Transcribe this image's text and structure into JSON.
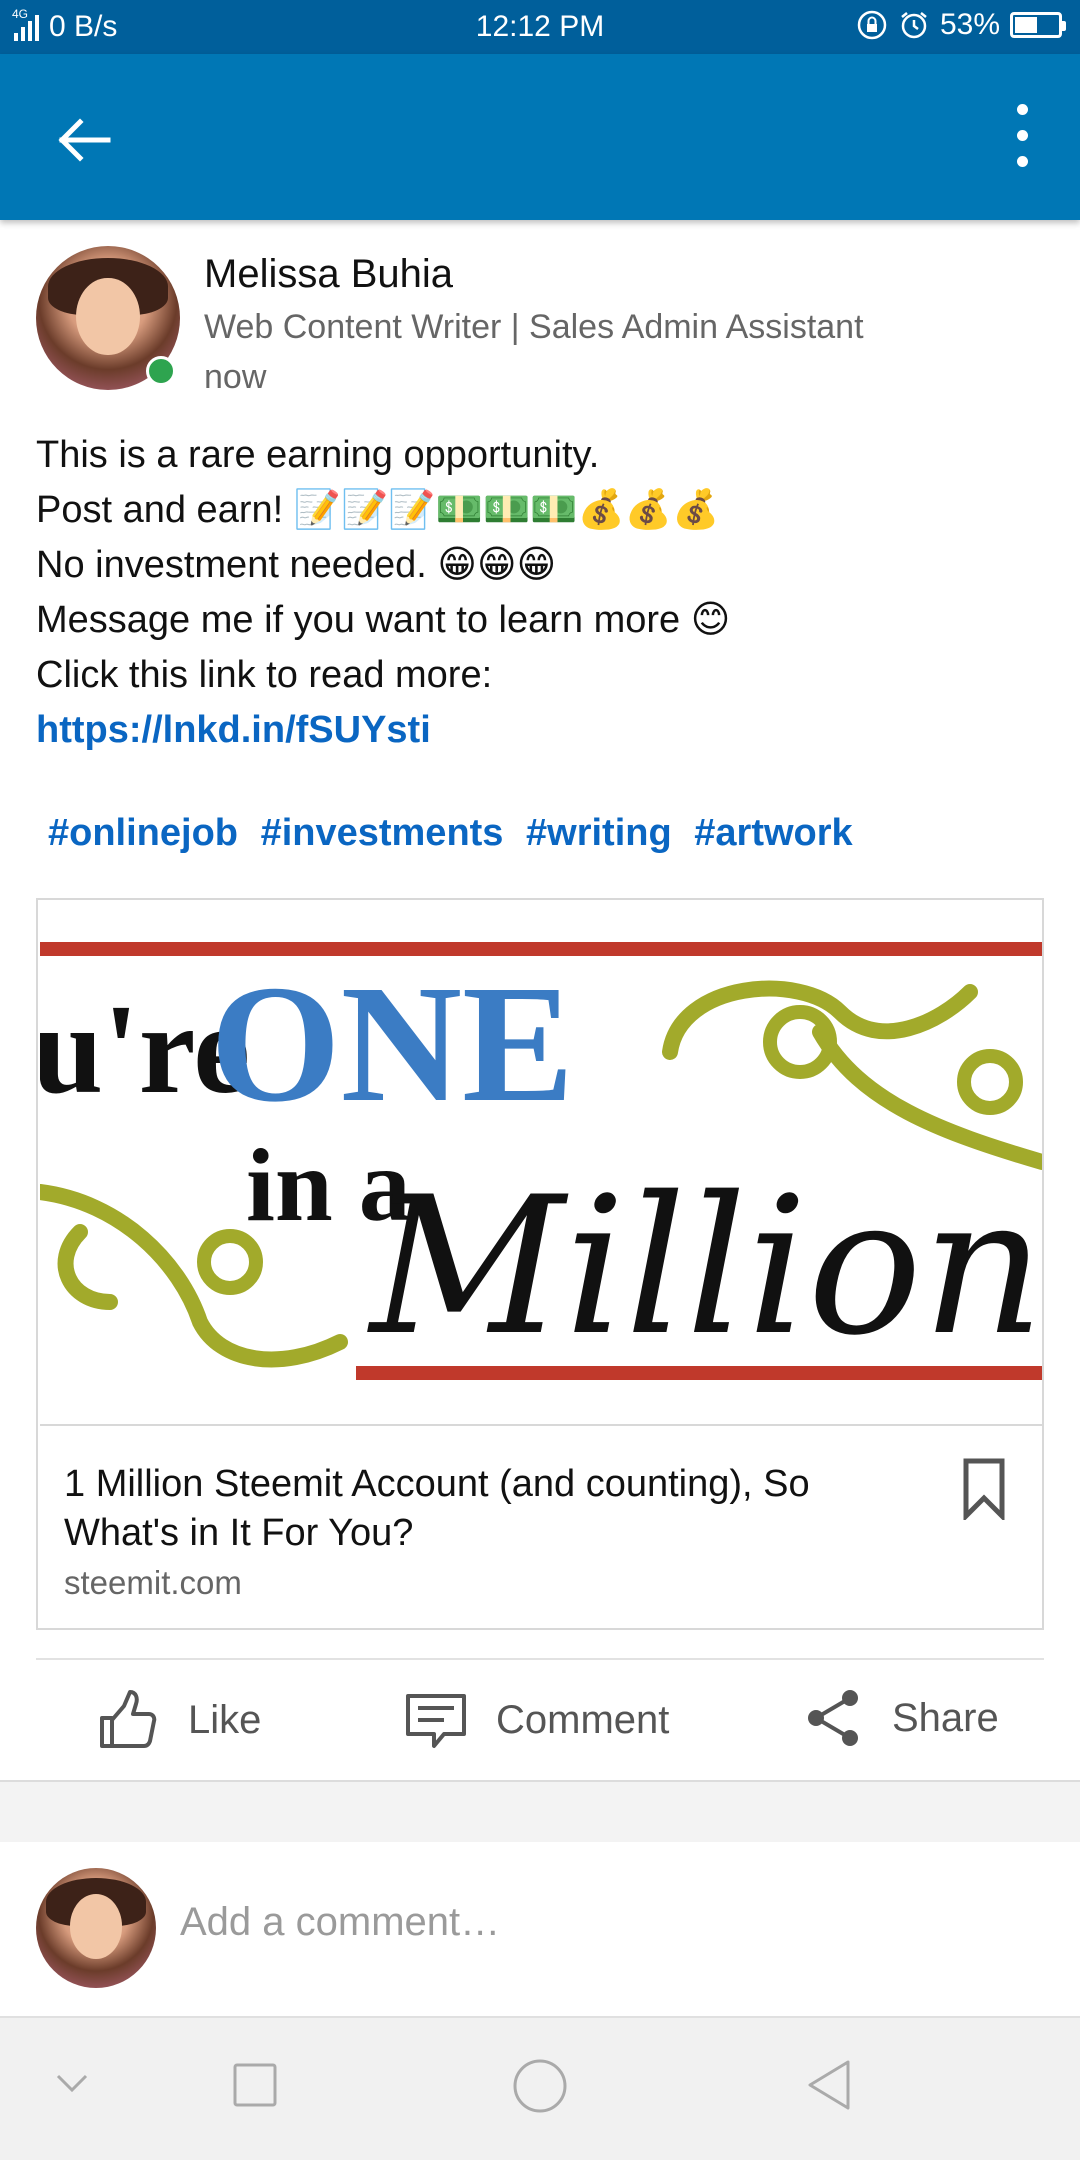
{
  "status_bar": {
    "network": "4G",
    "speed": "0 B/s",
    "time": "12:12 PM",
    "battery": "53%",
    "battery_level": 0.53
  },
  "app_bar": {
    "back_icon": "arrow-left-icon",
    "more_icon": "more-vertical-icon"
  },
  "post": {
    "author": {
      "name": "Melissa Buhia",
      "headline": "Web Content Writer | Sales Admin Assistant",
      "time": "now",
      "online": true
    },
    "body_lines": [
      "This is a rare earning opportunity.",
      "Post and earn! 📝📝📝💵💵💵💰💰💰",
      "No investment needed. 😁😁😁",
      "Message me if you want to learn more 😊",
      "Click this link to read more:"
    ],
    "link": "https://lnkd.in/fSUYsti",
    "hashtags": [
      "#onlinejob",
      "#investments",
      "#writing",
      "#artwork"
    ],
    "article": {
      "image_text": {
        "part1": "u're",
        "part2": "ONE",
        "part3": "in a",
        "part4": "Million"
      },
      "title": "1 Million Steemit Account (and counting), So What's in It For You?",
      "domain": "steemit.com"
    },
    "actions": {
      "like": "Like",
      "comment": "Comment",
      "share": "Share"
    }
  },
  "comment_bar": {
    "placeholder": "Add a comment…"
  },
  "colors": {
    "status_bar": "#005f9b",
    "app_bar": "#0077b5",
    "link": "#0a66c2",
    "online": "#2ea44f",
    "banner_red": "#c0392b",
    "banner_blue": "#3b7cc4",
    "banner_olive": "#a2aa2b"
  }
}
